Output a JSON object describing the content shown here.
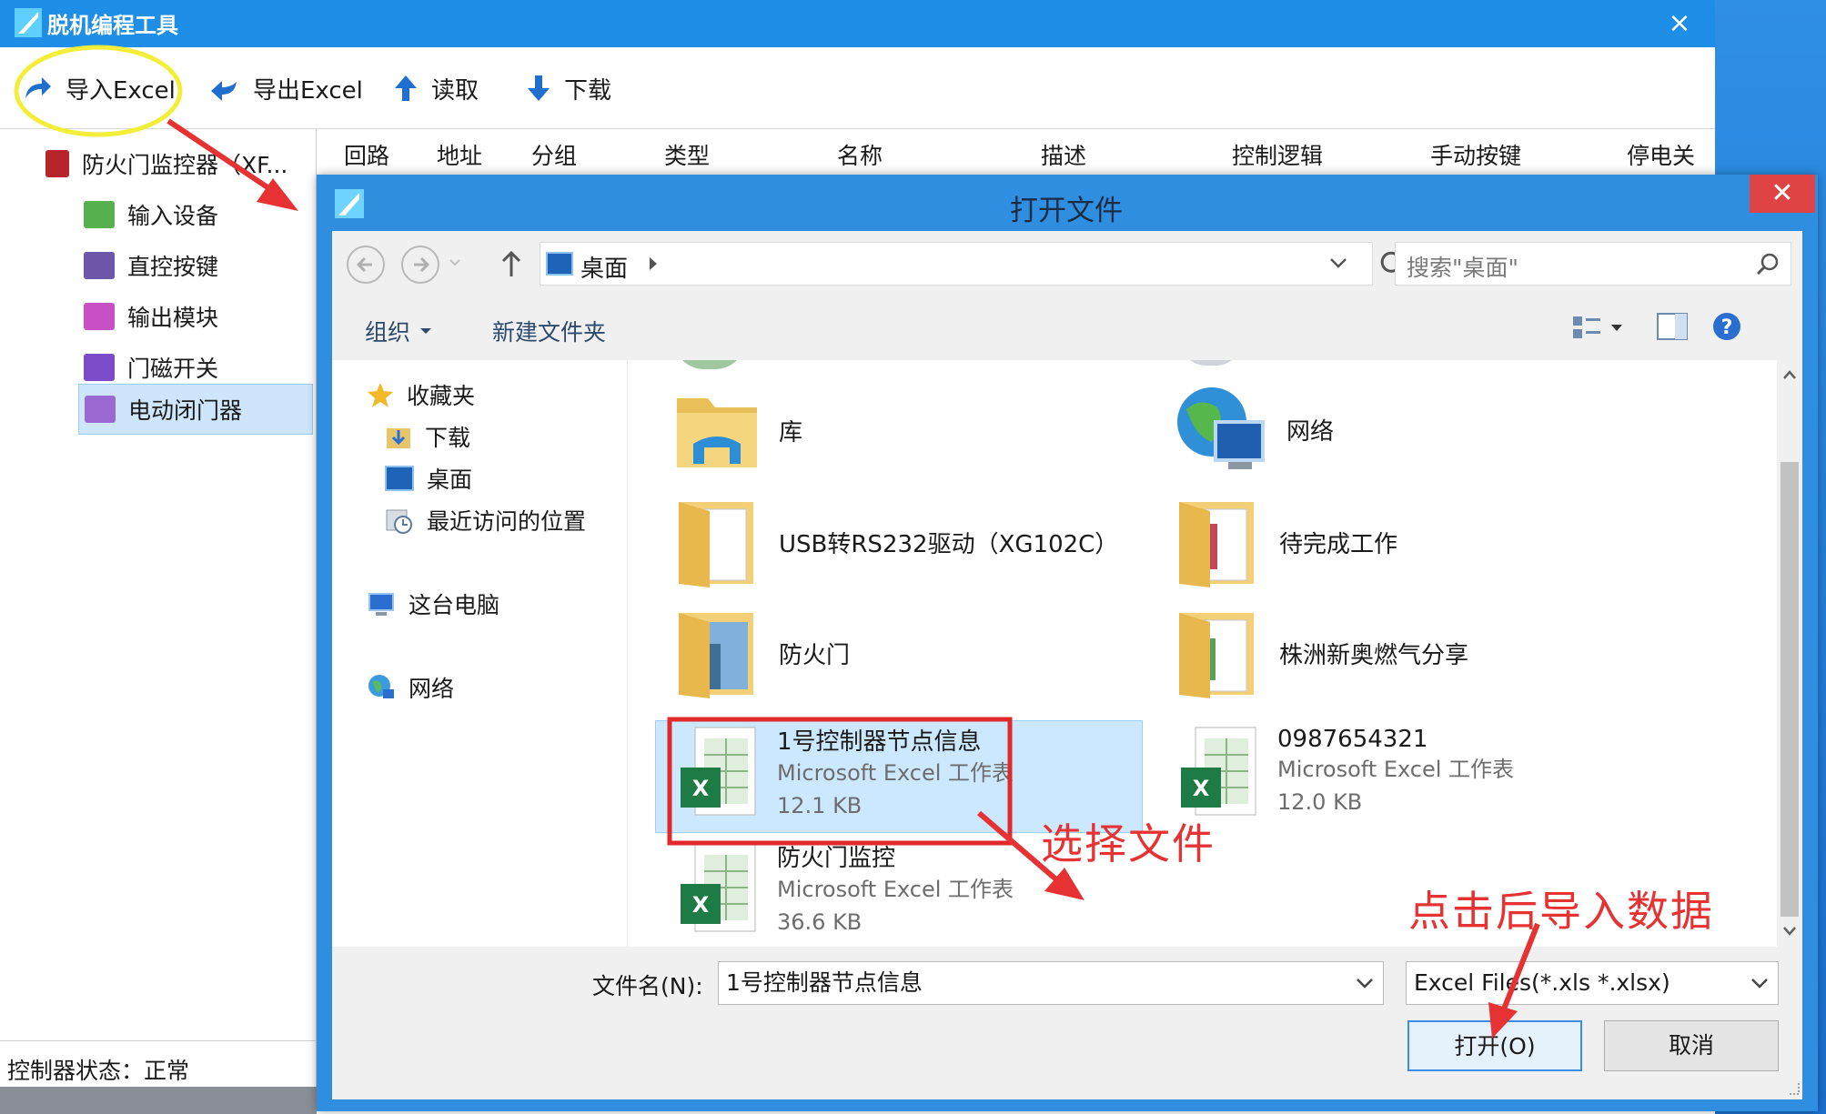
{
  "window": {
    "title": "脱机编程工具",
    "close": "×"
  },
  "toolbar": {
    "import_label": "导入Excel",
    "export_label": "导出Excel",
    "read_label": "读取",
    "download_label": "下载"
  },
  "tree": {
    "root": "防火门监控器（XF...",
    "items": [
      {
        "label": "输入设备",
        "color": "#57b04e"
      },
      {
        "label": "直控按键",
        "color": "#6c56a8"
      },
      {
        "label": "输出模块",
        "color": "#c84fc4"
      },
      {
        "label": "门磁开关",
        "color": "#7c4cc8"
      },
      {
        "label": "电动闭门器",
        "color": "#9a6ad2"
      }
    ]
  },
  "status": "控制器状态：正常",
  "columns": [
    "回路",
    "地址",
    "分组",
    "类型",
    "名称",
    "描述",
    "控制逻辑",
    "手动按键",
    "停电关"
  ],
  "dialog": {
    "title": "打开文件",
    "close": "✕",
    "path": "桌面",
    "search_placeholder": "搜索\"桌面\"",
    "organize": "组织",
    "new_folder": "新建文件夹",
    "nav": {
      "favorites": "收藏夹",
      "downloads": "下载",
      "desktop": "桌面",
      "recent": "最近访问的位置",
      "this_pc": "这台电脑",
      "network": "网络"
    },
    "files": [
      {
        "name": "库",
        "kind": "folder-library"
      },
      {
        "name": "网络",
        "kind": "network"
      },
      {
        "name": "USB转RS232驱动（XG102C）",
        "kind": "folder"
      },
      {
        "name": "待完成工作",
        "kind": "folder"
      },
      {
        "name": "防火门",
        "kind": "folder"
      },
      {
        "name": "株洲新奥燃气分享",
        "kind": "folder"
      },
      {
        "name": "1号控制器节点信息",
        "type": "Microsoft Excel 工作表",
        "size": "12.1 KB",
        "kind": "excel",
        "selected": true
      },
      {
        "name": "0987654321",
        "type": "Microsoft Excel 工作表",
        "size": "12.0 KB",
        "kind": "excel"
      },
      {
        "name": "防火门监控",
        "type": "Microsoft Excel 工作表",
        "size": "36.6 KB",
        "kind": "excel"
      }
    ],
    "filename_label": "文件名(N):",
    "filename_value": "1号控制器节点信息",
    "filter_value": "Excel Files(*.xls *.xlsx)",
    "open_button": "打开(O)",
    "cancel_button": "取消"
  },
  "annotations": {
    "select_file": "选择文件",
    "click_import": "点击后导入数据"
  }
}
